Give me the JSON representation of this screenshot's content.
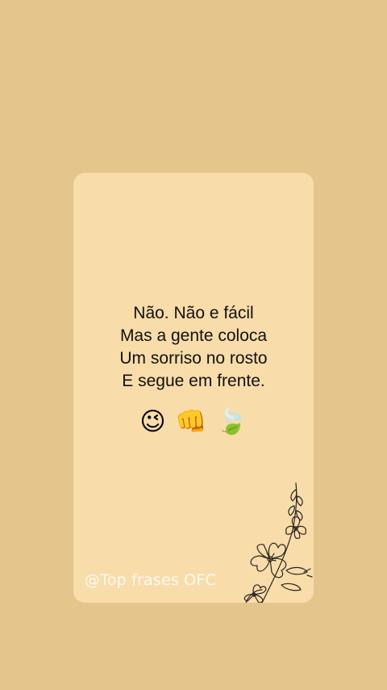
{
  "quote": {
    "lines": [
      "Não. Não e fácil",
      "Mas a gente coloca",
      "Um sorriso no rosto",
      "E segue em frente."
    ]
  },
  "emojis": [
    "😉",
    "👊",
    "🍃"
  ],
  "watermark": "@Top frases OFC",
  "colors": {
    "background": "#e4c68c",
    "card": "#f8dcaa",
    "text": "#111111"
  }
}
